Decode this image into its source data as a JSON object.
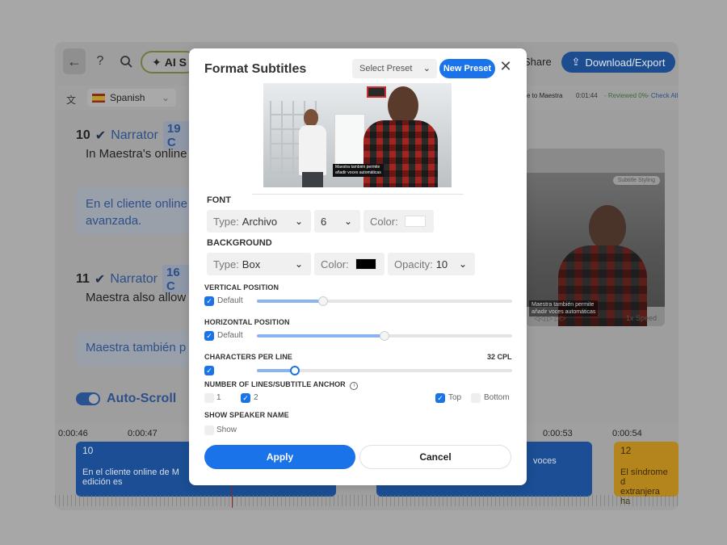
{
  "app": {
    "topbar": {
      "ai_label": "AI S",
      "share_label": "Share",
      "download_label": "Download/Export"
    },
    "langbar": {
      "language": "Spanish",
      "to_maestra": "e to Maestra",
      "timecode": "0:01:44",
      "reviewed": "- Reviewed 0%",
      "check_all": "- Check All"
    },
    "segments": [
      {
        "number": "10",
        "speaker": "Narrator",
        "duration": "19 C",
        "text": "In Maestra's online",
        "translation_line1": "En el cliente online",
        "translation_line2": "avanzada."
      },
      {
        "number": "11",
        "speaker": "Narrator",
        "duration": "16 C",
        "text": "Maestra also allow",
        "translation_line1": "Maestra también p"
      }
    ],
    "autoscroll_label": "Auto-Scroll",
    "video": {
      "styling_label": "Subtitle Styling",
      "caption_line1": "Maestra también permite",
      "caption_line2": "añadir voces automáticas",
      "speed_label": "1x Speed"
    },
    "timeline": {
      "ticks": [
        "0:00:46",
        "0:00:47",
        "0:00:53",
        "0:00:54"
      ],
      "blocks": [
        {
          "number": "10",
          "text_line1": "En el cliente online de M",
          "text_line2": "edición es"
        },
        {
          "number": "",
          "text_line1": "voces",
          "text_line2": ""
        },
        {
          "number": "12",
          "text_line1": "El síndrome d",
          "text_line2": "extranjera ha"
        }
      ]
    }
  },
  "modal": {
    "title": "Format Subtitles",
    "preset_placeholder": "Select Preset",
    "new_preset_label": "New Preset",
    "preview_caption_line1": "Maestra también permite",
    "preview_caption_line2": "añadir voces automáticas",
    "font": {
      "section_label": "FONT",
      "type_label": "Type:",
      "type_value": "Archivo",
      "size_value": "6",
      "color_label": "Color:",
      "color_value": "#ffffff"
    },
    "background": {
      "section_label": "BACKGROUND",
      "type_label": "Type:",
      "type_value": "Box",
      "color_label": "Color:",
      "color_value": "#000000",
      "opacity_label": "Opacity:",
      "opacity_value": "10"
    },
    "vertical_position": {
      "label": "VERTICAL POSITION",
      "default_label": "Default",
      "default_checked": true,
      "value_fraction": 0.26
    },
    "horizontal_position": {
      "label": "HORIZONTAL POSITION",
      "default_label": "Default",
      "default_checked": true,
      "value_fraction": 0.5
    },
    "characters_per_line": {
      "label": "CHARACTERS PER LINE",
      "value": "32 CPL",
      "checked": true,
      "value_fraction": 0.15
    },
    "lines_anchor": {
      "label": "NUMBER OF LINES/SUBTITLE ANCHOR",
      "option_1": "1",
      "option_2": "2",
      "selected_lines": "2",
      "anchor_top": "Top",
      "anchor_bottom": "Bottom",
      "selected_anchor": "Top"
    },
    "speaker_name": {
      "label": "SHOW SPEAKER NAME",
      "show_label": "Show",
      "checked": false
    },
    "apply_label": "Apply",
    "cancel_label": "Cancel"
  },
  "colors": {
    "accent": "#1a73e8",
    "slider_fill": "#8ab4f0"
  }
}
